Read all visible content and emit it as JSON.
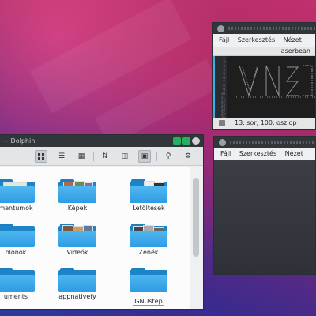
{
  "dolphin": {
    "title": "— Dolphin",
    "items": [
      {
        "label": "mentumok"
      },
      {
        "label": "Képek"
      },
      {
        "label": "Letöltések"
      },
      {
        "label": "blonok"
      },
      {
        "label": "Videók"
      },
      {
        "label": "Zenék"
      },
      {
        "label": "uments"
      },
      {
        "label": "appnativefy"
      },
      {
        "label": "GNUstep"
      }
    ]
  },
  "editor_top": {
    "menu": [
      "Fájl",
      "Szerkesztés",
      "Nézet"
    ],
    "tab_title": "laserbean",
    "line_numbers": [
      "1",
      "2",
      "3",
      "4",
      "5",
      "6",
      "7",
      "8",
      "9",
      "10",
      "11",
      "12",
      "13",
      "14",
      "15",
      "16",
      "17",
      "18"
    ],
    "status": "13. sor, 100. oszlop"
  },
  "editor_bottom": {
    "menu": [
      "Fájl",
      "Szerkesztés",
      "Nézet"
    ]
  },
  "colors": {
    "accent": "#3daee9",
    "folder": "#2e9be3",
    "titlebar": "#31363b"
  }
}
